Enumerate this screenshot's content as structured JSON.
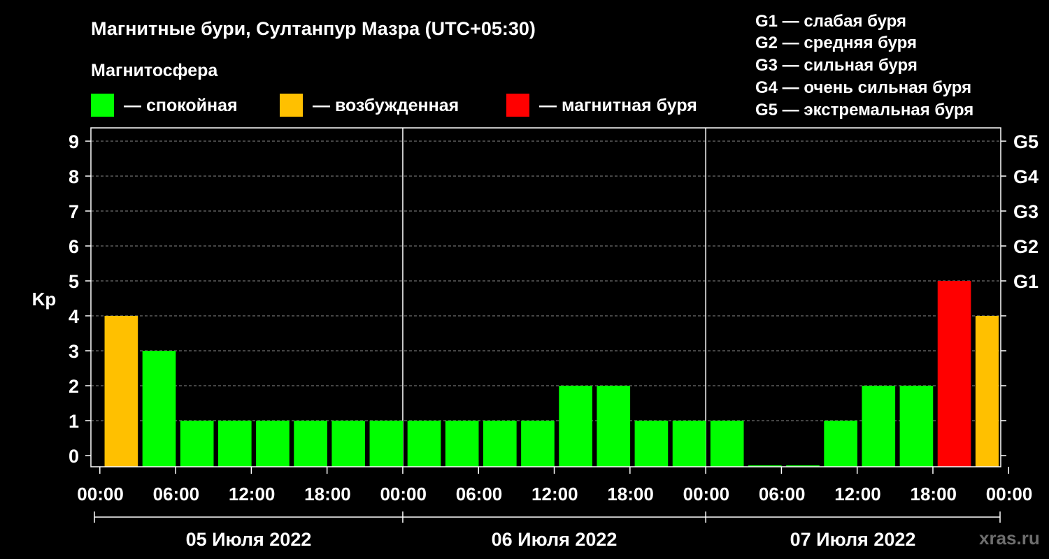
{
  "chart_data": {
    "type": "bar",
    "title": "Магнитные бури, Султанпур Мазра (UTC+05:30)",
    "legend_title": "Магнитосфера",
    "ylabel": "Kp",
    "ylim": [
      0,
      9
    ],
    "y_ticks": [
      "0",
      "1",
      "2",
      "3",
      "4",
      "5",
      "6",
      "7",
      "8",
      "9"
    ],
    "right_ticks": [
      {
        "kp": 5,
        "label": "G1"
      },
      {
        "kp": 6,
        "label": "G2"
      },
      {
        "kp": 7,
        "label": "G3"
      },
      {
        "kp": 8,
        "label": "G4"
      },
      {
        "kp": 9,
        "label": "G5"
      }
    ],
    "legend": [
      {
        "label": "— спокойная",
        "color": "#00ff00"
      },
      {
        "label": "— возбужденная",
        "color": "#ffc000"
      },
      {
        "label": "— магнитная буря",
        "color": "#ff0000"
      }
    ],
    "g_scale": [
      "G1 — слабая буря",
      "G2 — средняя буря",
      "G3 — сильная буря",
      "G4 — очень сильная буря",
      "G5 — экстремальная буря"
    ],
    "x_tick_labels": [
      "00:00",
      "06:00",
      "12:00",
      "18:00",
      "00:00",
      "06:00",
      "12:00",
      "18:00",
      "00:00",
      "06:00",
      "12:00",
      "18:00",
      "00:00"
    ],
    "days": [
      "05 Июля 2022",
      "06 Июля 2022",
      "07 Июля 2022"
    ],
    "grid": true,
    "legend_position": "top",
    "watermark": "xras.ru",
    "series": [
      {
        "values": [
          4,
          3,
          1,
          1,
          1,
          1,
          1,
          1,
          1,
          1,
          1,
          1,
          2,
          2,
          1,
          1,
          1,
          0,
          0,
          1,
          2,
          2,
          5,
          4,
          4
        ],
        "colors": [
          "#ffc000",
          "#00ff00",
          "#00ff00",
          "#00ff00",
          "#00ff00",
          "#00ff00",
          "#00ff00",
          "#00ff00",
          "#00ff00",
          "#00ff00",
          "#00ff00",
          "#00ff00",
          "#00ff00",
          "#00ff00",
          "#00ff00",
          "#00ff00",
          "#00ff00",
          "#00ff00",
          "#00ff00",
          "#00ff00",
          "#00ff00",
          "#00ff00",
          "#ff0000",
          "#ffc000",
          "#ffc000"
        ]
      }
    ]
  }
}
